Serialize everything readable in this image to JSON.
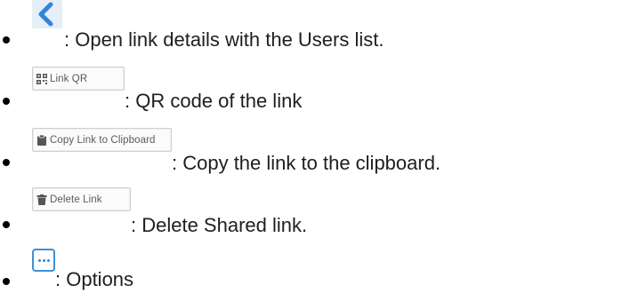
{
  "items": [
    {
      "icon": "chevron-left-icon",
      "description": ": Open link details with the Users list."
    },
    {
      "icon": "qr-code-icon",
      "button_label": "Link QR",
      "description": ": QR code of the link"
    },
    {
      "icon": "clipboard-icon",
      "button_label": "Copy Link to Clipboard",
      "description": ": Copy the link to the clipboard."
    },
    {
      "icon": "trash-icon",
      "button_label": "Delete Link",
      "description": ": Delete Shared link."
    },
    {
      "icon": "ellipsis-icon",
      "description": ": Options"
    }
  ],
  "colors": {
    "accent_blue": "#2f86d6",
    "chevron_bg": "#e6eef7",
    "button_border": "#cfcfcf",
    "button_text": "#5a5a5a"
  }
}
